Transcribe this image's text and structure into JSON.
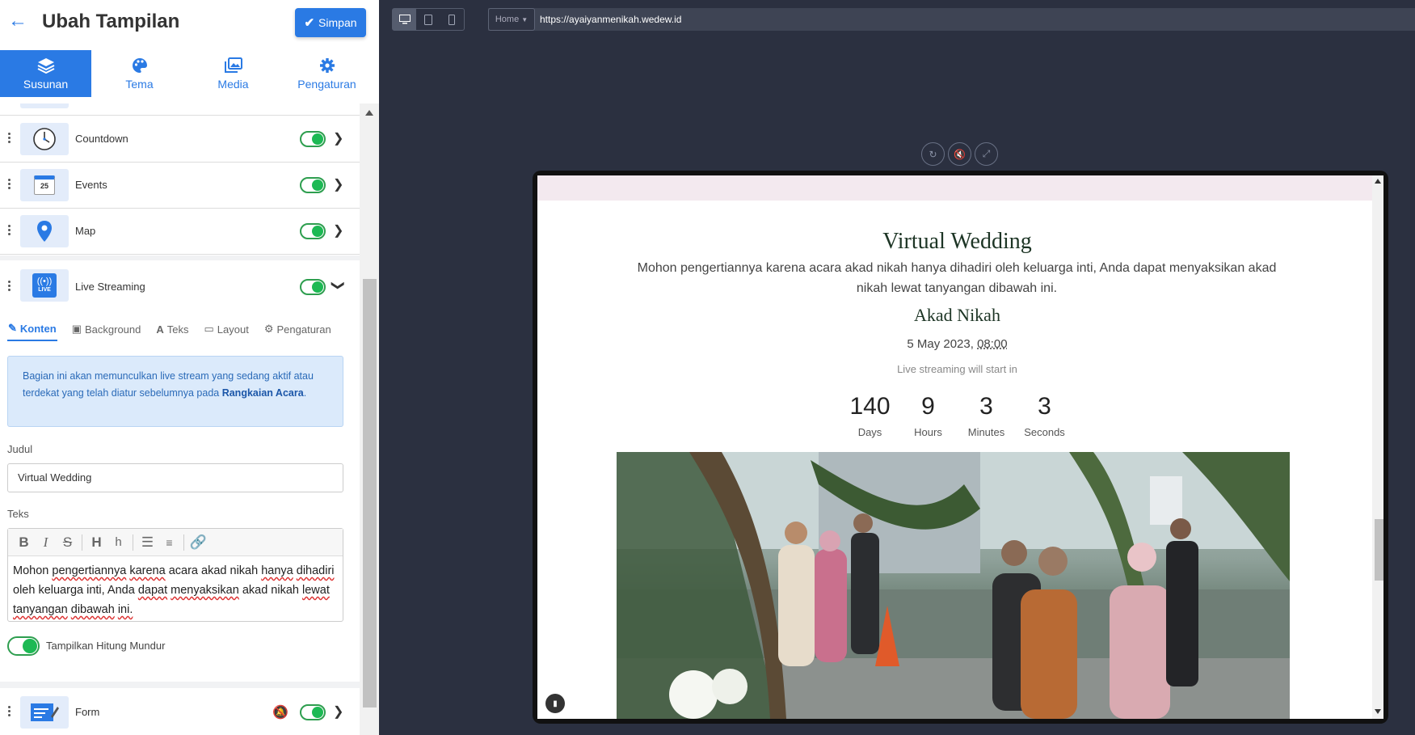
{
  "header": {
    "title": "Ubah Tampilan",
    "save_label": "Simpan"
  },
  "main_tabs": [
    {
      "label": "Susunan",
      "icon": "layers-icon",
      "active": true
    },
    {
      "label": "Tema",
      "icon": "palette-icon",
      "active": false
    },
    {
      "label": "Media",
      "icon": "images-icon",
      "active": false
    },
    {
      "label": "Pengaturan",
      "icon": "gear-icon",
      "active": false
    }
  ],
  "sections": [
    {
      "label": "Countdown",
      "icon": "clock-icon",
      "enabled": true,
      "expanded": false
    },
    {
      "label": "Events",
      "icon": "calendar-icon",
      "calendar_day": "25",
      "enabled": true,
      "expanded": false
    },
    {
      "label": "Map",
      "icon": "map-pin-icon",
      "enabled": true,
      "expanded": false
    },
    {
      "label": "Live Streaming",
      "icon": "live-icon",
      "live_badge": "LIVE",
      "enabled": true,
      "expanded": true
    },
    {
      "label": "Form",
      "icon": "form-icon",
      "enabled": true,
      "expanded": false
    }
  ],
  "live_streaming": {
    "sub_tabs": [
      {
        "label": "Konten",
        "icon": "edit-icon",
        "active": true
      },
      {
        "label": "Background",
        "icon": "image-icon",
        "active": false
      },
      {
        "label": "Teks",
        "icon": "font-icon",
        "active": false
      },
      {
        "label": "Layout",
        "icon": "window-icon",
        "active": false
      },
      {
        "label": "Pengaturan",
        "icon": "gear-icon",
        "active": false
      }
    ],
    "info_text_1": "Bagian ini akan memunculkan live stream yang sedang aktif atau terdekat yang telah diatur sebelumnya pada ",
    "info_link": "Rangkaian Acara",
    "info_text_2": ".",
    "judul_label": "Judul",
    "judul_value": "Virtual Wedding",
    "teks_label": "Teks",
    "editor_tools": [
      "B",
      "I",
      "S",
      "H",
      "h",
      "bullet-list-icon",
      "numbered-list-icon",
      "link-icon"
    ],
    "teks_value": "Mohon pengertiannya karena acara akad nikah hanya dihadiri oleh keluarga inti, Anda dapat menyaksikan akad nikah lewat tanyangan dibawah ini.",
    "show_countdown_label": "Tampilkan Hitung Mundur",
    "show_countdown": true
  },
  "preview_bar": {
    "devices": [
      "desktop-icon",
      "tablet-icon",
      "mobile-icon"
    ],
    "active_device": "desktop",
    "page_select": "Home",
    "url": "https://ayaiyanmenikah.wedew.id",
    "controls": [
      "refresh-icon",
      "mute-icon",
      "expand-icon"
    ]
  },
  "preview": {
    "title": "Virtual Wedding",
    "description": "Mohon pengertiannya karena acara akad nikah hanya dihadiri oleh keluarga inti, Anda dapat menyaksikan akad nikah lewat tanyangan dibawah ini.",
    "event_name": "Akad Nikah",
    "event_date": "5 May 2023, ",
    "event_time": "08:00",
    "will_start": "Live streaming will start in",
    "countdown": [
      {
        "value": "140",
        "unit": "Days"
      },
      {
        "value": "9",
        "unit": "Hours"
      },
      {
        "value": "3",
        "unit": "Minutes"
      },
      {
        "value": "3",
        "unit": "Seconds"
      }
    ]
  },
  "colors": {
    "accent": "#2a7ae4",
    "toggle_on": "#1db954",
    "preview_bg": "#2b3040",
    "preview_heading": "#1d3525"
  }
}
